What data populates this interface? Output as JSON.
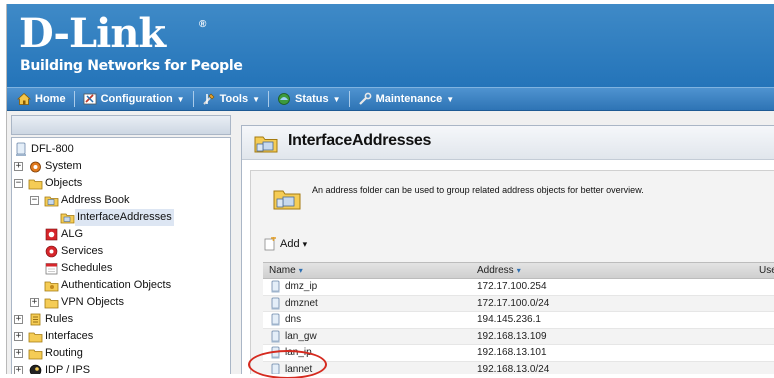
{
  "brand": {
    "logo_text": "D-Link",
    "registered_mark": "®",
    "tagline": "Building Networks for People"
  },
  "menu": {
    "items": [
      {
        "label": "Home",
        "icon": "home-icon"
      },
      {
        "label": "Configuration",
        "icon": "configuration-icon"
      },
      {
        "label": "Tools",
        "icon": "tools-icon"
      },
      {
        "label": "Status",
        "icon": "status-icon"
      },
      {
        "label": "Maintenance",
        "icon": "maintenance-icon"
      }
    ]
  },
  "tree": {
    "nodes": [
      {
        "label": "DFL-800",
        "expander": "",
        "icon": "device-icon"
      },
      {
        "label": "System",
        "expander": "+",
        "icon": "system-icon"
      },
      {
        "label": "Objects",
        "expander": "−",
        "icon": "folder-icon"
      },
      {
        "label": "Address Book",
        "expander": "−",
        "icon": "address-book-icon"
      },
      {
        "label": "InterfaceAddresses",
        "expander": "",
        "icon": "address-folder-icon",
        "selected": true
      },
      {
        "label": "ALG",
        "expander": "",
        "icon": "alg-icon"
      },
      {
        "label": "Services",
        "expander": "",
        "icon": "services-icon"
      },
      {
        "label": "Schedules",
        "expander": "",
        "icon": "schedules-icon"
      },
      {
        "label": "Authentication Objects",
        "expander": "",
        "icon": "authentication-icon"
      },
      {
        "label": "VPN Objects",
        "expander": "+",
        "icon": "vpn-folder-icon"
      },
      {
        "label": "Rules",
        "expander": "+",
        "icon": "rules-icon"
      },
      {
        "label": "Interfaces",
        "expander": "+",
        "icon": "interfaces-icon"
      },
      {
        "label": "Routing",
        "expander": "+",
        "icon": "routing-icon"
      },
      {
        "label": "IDP / IPS",
        "expander": "+",
        "icon": "idp-icon"
      }
    ]
  },
  "page": {
    "title": "InterfaceAddresses",
    "description": "An address folder can be used to group related address objects for better overview.",
    "add_label": "Add",
    "add_caret": "▾"
  },
  "table": {
    "columns": [
      {
        "label": "Name",
        "sort": "▾"
      },
      {
        "label": "Address",
        "sort": "▾"
      },
      {
        "label": "User",
        "sort": ""
      }
    ],
    "rows": [
      {
        "name": "dmz_ip",
        "address": "172.17.100.254"
      },
      {
        "name": "dmznet",
        "address": "172.17.100.0/24"
      },
      {
        "name": "dns",
        "address": "194.145.236.1"
      },
      {
        "name": "lan_gw",
        "address": "192.168.13.109"
      },
      {
        "name": "lan_ip",
        "address": "192.168.13.101"
      },
      {
        "name": "lannet",
        "address": "192.168.13.0/24"
      }
    ]
  },
  "colors": {
    "banner": "#2474b9",
    "highlight": "#d52a1f"
  }
}
